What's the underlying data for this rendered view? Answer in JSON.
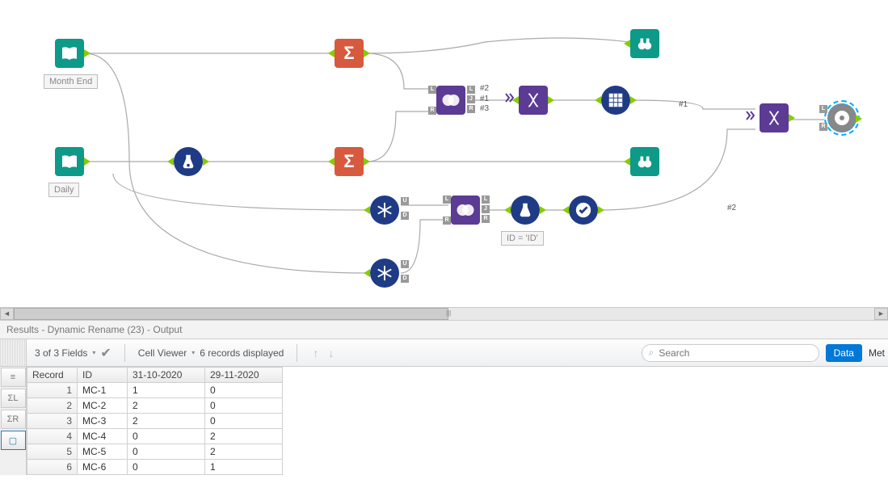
{
  "canvas": {
    "labels": {
      "month_end": "Month End",
      "daily": "Daily",
      "id_filter": "ID = 'ID'"
    },
    "anno": {
      "hash1": "#1",
      "hash2": "#2",
      "hash3": "#3",
      "hash1b": "#1",
      "hash2b": "#2"
    }
  },
  "results": {
    "title": "Results - Dynamic Rename (23) - Output",
    "fields_label": "3 of 3 Fields",
    "cell_viewer": "Cell Viewer",
    "records_label": "6 records displayed",
    "search_placeholder": "Search",
    "btn_data": "Data",
    "btn_meta": "Met",
    "side": {
      "list": "≡",
      "sigmaL": "ΣL",
      "sigmaR": "ΣR",
      "box": "▢"
    },
    "columns": [
      "Record",
      "ID",
      "31-10-2020",
      "29-11-2020"
    ],
    "rows": [
      {
        "rec": "1",
        "id": "MC-1",
        "c1": "1",
        "c2": "0"
      },
      {
        "rec": "2",
        "id": "MC-2",
        "c1": "2",
        "c2": "0"
      },
      {
        "rec": "3",
        "id": "MC-3",
        "c1": "2",
        "c2": "0"
      },
      {
        "rec": "4",
        "id": "MC-4",
        "c1": "0",
        "c2": "2"
      },
      {
        "rec": "5",
        "id": "MC-5",
        "c1": "0",
        "c2": "2"
      },
      {
        "rec": "6",
        "id": "MC-6",
        "c1": "0",
        "c2": "1"
      }
    ]
  }
}
